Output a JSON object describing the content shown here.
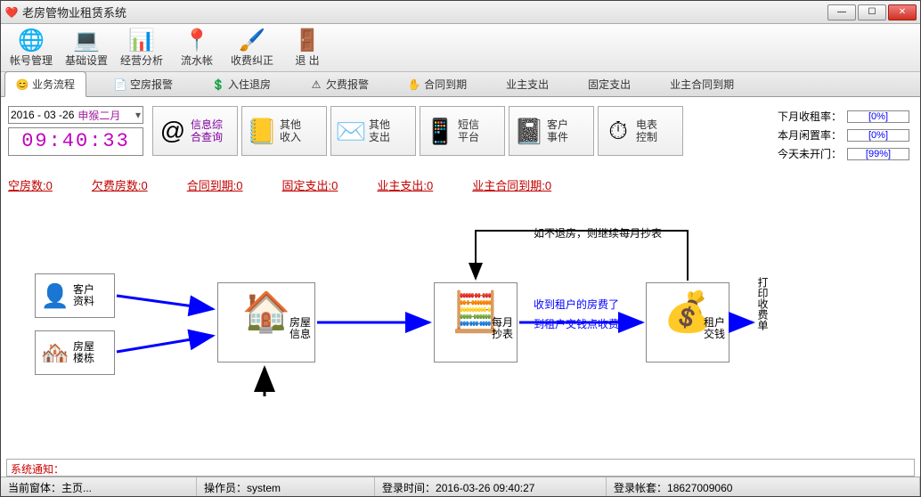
{
  "title": "老房管物业租赁系统",
  "toolbar": [
    {
      "label": "帐号管理",
      "icon": "🌐",
      "color": "#3a8"
    },
    {
      "label": "基础设置",
      "icon": "💻",
      "color": "#555"
    },
    {
      "label": "经营分析",
      "icon": "📊",
      "color": "#c33"
    },
    {
      "label": "流水帐",
      "icon": "📍",
      "color": "#b22"
    },
    {
      "label": "收费纠正",
      "icon": "🖌️",
      "color": "#237"
    },
    {
      "label": "退 出",
      "icon": "🚪",
      "color": "#3a3"
    }
  ],
  "tabs": [
    {
      "label": "业务流程",
      "icon": "😊",
      "active": true
    },
    {
      "label": "空房报警",
      "icon": "📄"
    },
    {
      "label": "入住退房",
      "icon": "💲"
    },
    {
      "label": "欠费报警",
      "icon": "⚠"
    },
    {
      "label": "合同到期",
      "icon": "✋"
    },
    {
      "label": "业主支出"
    },
    {
      "label": "固定支出"
    },
    {
      "label": "业主合同到期"
    }
  ],
  "date": {
    "value": "2016 - 03 -26",
    "lunar": "申猴二月",
    "drop": "▾"
  },
  "clock": "09:40:33",
  "bigbtns": [
    {
      "label": "信息综\n合查询",
      "icon": "@",
      "purple": true
    },
    {
      "label": "其他\n收入",
      "icon": "📒"
    },
    {
      "label": "其他\n支出",
      "icon": "✉️"
    },
    {
      "label": "短信\n平台",
      "icon": "📱"
    },
    {
      "label": "客户\n事件",
      "icon": "📓"
    },
    {
      "label": "电表\n控制",
      "icon": "⏱"
    }
  ],
  "rates": [
    {
      "label": "下月收租率：",
      "val": "[0%]"
    },
    {
      "label": "本月闲置率：",
      "val": "[0%]"
    },
    {
      "label": "今天未开门：",
      "val": "[99%]"
    }
  ],
  "stats": [
    {
      "text": "空房数:0"
    },
    {
      "text": "欠费房数:0"
    },
    {
      "text": "合同到期:0"
    },
    {
      "text": "固定支出:0"
    },
    {
      "text": "业主支出:0"
    },
    {
      "text": "业主合同到期:0"
    }
  ],
  "flow": {
    "customer": "客户\n资料",
    "building": "房屋\n楼栋",
    "houseinfo": "房屋\n信息",
    "meter": "每月\n抄表",
    "pay": "租户\n交钱",
    "print": "打印收费单",
    "note1": "收到租户的房费了",
    "note2": "到租户交钱点收费",
    "loop": "如不退房，则继续每月抄表"
  },
  "sysnotice_label": "系统通知：",
  "status": {
    "win_label": "当前窗体：",
    "win_val": "主页...",
    "op_label": "操作员：",
    "op_val": "system",
    "login_label": "登录时间：",
    "login_val": "2016-03-26 09:40:27",
    "acct_label": "登录帐套：",
    "acct_val": "18627009060"
  }
}
